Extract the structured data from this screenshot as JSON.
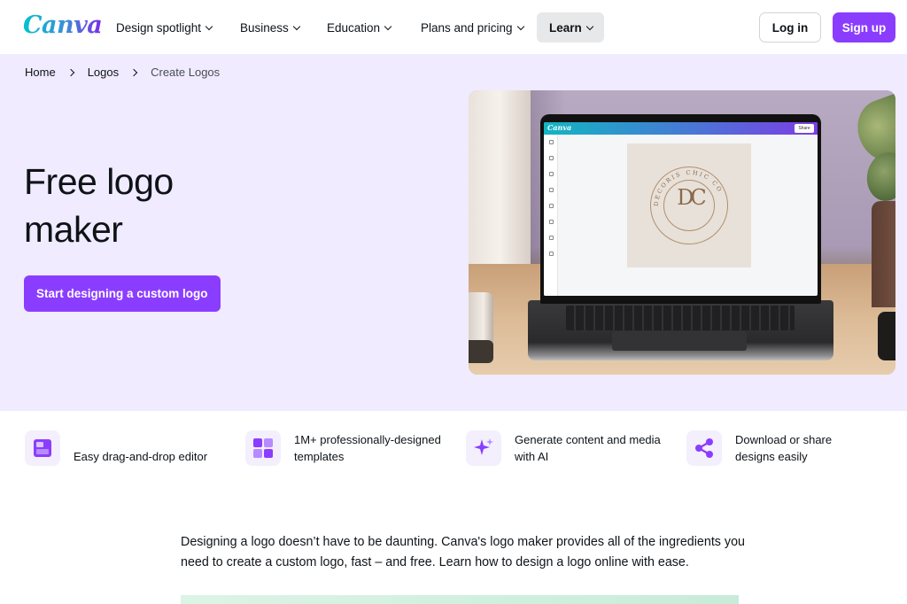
{
  "brand": {
    "name": "Canva",
    "accent": "#8b3dff",
    "hero_bg": "#f0ebff"
  },
  "nav": {
    "items": [
      {
        "label": "Design spotlight",
        "has_dropdown": true
      },
      {
        "label": "Business",
        "has_dropdown": true
      },
      {
        "label": "Education",
        "has_dropdown": true
      },
      {
        "label": "Plans and pricing",
        "has_dropdown": true
      },
      {
        "label": "Learn",
        "has_dropdown": true,
        "active": true
      }
    ],
    "login_label": "Log in",
    "signup_label": "Sign up"
  },
  "breadcrumb": [
    "Home",
    "Logos",
    "Create Logos"
  ],
  "hero": {
    "title": "Free logo maker",
    "cta_label": "Start designing a custom logo",
    "image": {
      "app_logo": "Canva",
      "share_label": "Share",
      "monogram": "DC",
      "ring_text": "DECORIS CHIC CO"
    }
  },
  "features": [
    {
      "icon": "drag-drop-editor-icon",
      "text": "Easy drag-and-drop editor"
    },
    {
      "icon": "templates-icon",
      "text": "1M+ professionally-designed templates"
    },
    {
      "icon": "sparkle-ai-icon",
      "text": "Generate content and media with AI"
    },
    {
      "icon": "share-icon",
      "text": "Download or share designs easily"
    }
  ],
  "description": "Designing a logo doesn’t have to be daunting. Canva's logo maker provides all of the ingredients you need to create a custom logo, fast – and free. Learn how to design a logo online with ease."
}
